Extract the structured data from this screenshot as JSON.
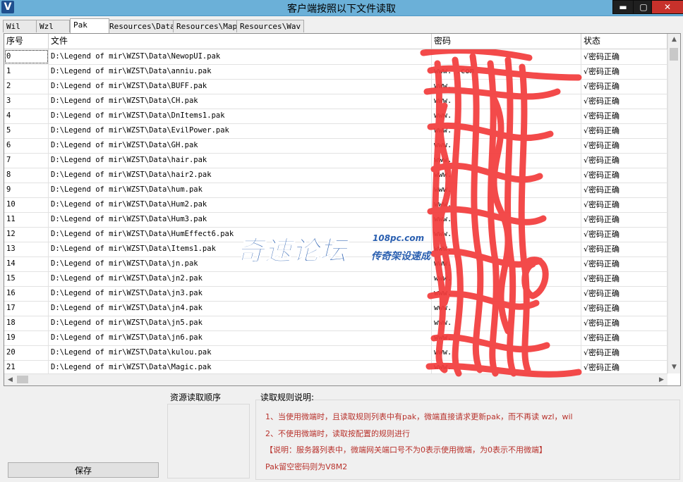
{
  "window": {
    "title": "客户端按照以下文件读取",
    "app_icon_letter": "V",
    "minimize_glyph": "▬",
    "maximize_glyph": "▢",
    "close_glyph": "✕"
  },
  "tabs": [
    {
      "label": "Wil",
      "active": false
    },
    {
      "label": "Wzl",
      "active": false
    },
    {
      "label": "Pak",
      "active": true
    },
    {
      "label": "Resources\\Data",
      "active": false
    },
    {
      "label": "Resources\\Map",
      "active": false
    },
    {
      "label": "Resources\\Wav",
      "active": false
    }
  ],
  "table": {
    "columns": [
      "序号",
      "文件",
      "密码",
      "状态"
    ],
    "rows": [
      {
        "idx": "0",
        "file": "D:\\Legend of mir\\WZST\\Data\\NewopUI.pak",
        "password": "",
        "status": "√密码正确"
      },
      {
        "idx": "1",
        "file": "D:\\Legend of mir\\WZST\\Data\\anniu.pak",
        "password": "www.    .com",
        "status": "√密码正确"
      },
      {
        "idx": "2",
        "file": "D:\\Legend of mir\\WZST\\Data\\BUFF.pak",
        "password": "www.",
        "status": "√密码正确"
      },
      {
        "idx": "3",
        "file": "D:\\Legend of mir\\WZST\\Data\\CH.pak",
        "password": "www.",
        "status": "√密码正确"
      },
      {
        "idx": "4",
        "file": "D:\\Legend of mir\\WZST\\Data\\DnItems1.pak",
        "password": "www.",
        "status": "√密码正确"
      },
      {
        "idx": "5",
        "file": "D:\\Legend of mir\\WZST\\Data\\EvilPower.pak",
        "password": "www.",
        "status": "√密码正确"
      },
      {
        "idx": "6",
        "file": "D:\\Legend of mir\\WZST\\Data\\GH.pak",
        "password": "www.",
        "status": "√密码正确"
      },
      {
        "idx": "7",
        "file": "D:\\Legend of mir\\WZST\\Data\\hair.pak",
        "password": "www.",
        "status": "√密码正确"
      },
      {
        "idx": "8",
        "file": "D:\\Legend of mir\\WZST\\Data\\hair2.pak",
        "password": "www.",
        "status": "√密码正确"
      },
      {
        "idx": "9",
        "file": "D:\\Legend of mir\\WZST\\Data\\hum.pak",
        "password": "www.",
        "status": "√密码正确"
      },
      {
        "idx": "10",
        "file": "D:\\Legend of mir\\WZST\\Data\\Hum2.pak",
        "password": "www.",
        "status": "√密码正确"
      },
      {
        "idx": "11",
        "file": "D:\\Legend of mir\\WZST\\Data\\Hum3.pak",
        "password": "www.",
        "status": "√密码正确"
      },
      {
        "idx": "12",
        "file": "D:\\Legend of mir\\WZST\\Data\\HumEffect6.pak",
        "password": "www.",
        "status": "√密码正确"
      },
      {
        "idx": "13",
        "file": "D:\\Legend of mir\\WZST\\Data\\Items1.pak",
        "password": "www.",
        "status": "√密码正确"
      },
      {
        "idx": "14",
        "file": "D:\\Legend of mir\\WZST\\Data\\jn.pak",
        "password": "www.",
        "status": "√密码正确"
      },
      {
        "idx": "15",
        "file": "D:\\Legend of mir\\WZST\\Data\\jn2.pak",
        "password": "www.",
        "status": "√密码正确"
      },
      {
        "idx": "16",
        "file": "D:\\Legend of mir\\WZST\\Data\\jn3.pak",
        "password": "www.",
        "status": "√密码正确"
      },
      {
        "idx": "17",
        "file": "D:\\Legend of mir\\WZST\\Data\\jn4.pak",
        "password": "www.",
        "status": "√密码正确"
      },
      {
        "idx": "18",
        "file": "D:\\Legend of mir\\WZST\\Data\\jn5.pak",
        "password": "www.",
        "status": "√密码正确"
      },
      {
        "idx": "19",
        "file": "D:\\Legend of mir\\WZST\\Data\\jn6.pak",
        "password": "www.",
        "status": "√密码正确"
      },
      {
        "idx": "20",
        "file": "D:\\Legend of mir\\WZST\\Data\\kulou.pak",
        "password": "www.",
        "status": "√密码正确"
      },
      {
        "idx": "21",
        "file": "D:\\Legend of mir\\WZST\\Data\\Magic.pak",
        "password": "www.",
        "status": "√密码正确"
      }
    ]
  },
  "watermark": {
    "big": "奇速论坛",
    "url": "108pc.com",
    "sub": "传奇架设速成"
  },
  "bottom": {
    "save_label": "保存",
    "order_label": "资源读取顺序",
    "rules_label": "读取规则说明:",
    "rules": [
      "1、当使用微端时，且读取规则列表中有pak，微端直接请求更新pak，而不再读 wzl，wil",
      "2、不使用微端时，读取按配置的规则进行",
      "【说明：服务器列表中，微端网关端口号不为0表示使用微端，为0表示不用微端】",
      "Pak留空密码则为V8M2"
    ]
  },
  "colors": {
    "title_bar": "#6bb0d8",
    "rule_text": "#b8322c",
    "watermark": "#2a5fb0",
    "scribble": "#f23b3b"
  }
}
